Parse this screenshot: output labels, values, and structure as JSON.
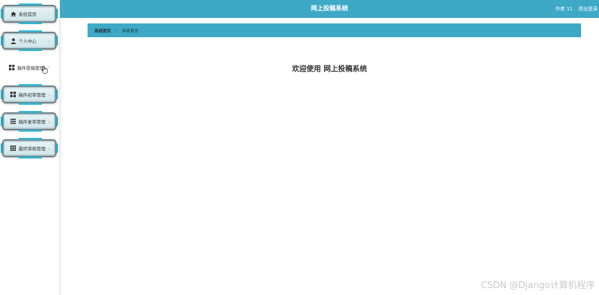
{
  "header": {
    "title": "网上投稿系统",
    "user": "作者 11",
    "logout": "退出登录"
  },
  "sidebar": {
    "items": [
      {
        "label": "系统首页",
        "icon": "home-icon"
      },
      {
        "label": "个人中心",
        "icon": "user-icon"
      },
      {
        "label": "稿件投稿管理",
        "icon": "grid-icon"
      },
      {
        "label": "稿件初审管理",
        "icon": "grid-icon"
      },
      {
        "label": "稿件复审管理",
        "icon": "list-icon"
      },
      {
        "label": "最终审核管理",
        "icon": "apps-icon"
      }
    ]
  },
  "breadcrumb": {
    "home": "系统首页",
    "separator": "⋮",
    "current": "系统首页"
  },
  "main": {
    "welcome": "欢迎使用 网上投稿系统"
  },
  "watermark": "CSDN @Django计算机程序",
  "colors": {
    "accent": "#3ea9c6",
    "menu_bg": "#d6ebee",
    "menu_border": "#6e7c83"
  }
}
